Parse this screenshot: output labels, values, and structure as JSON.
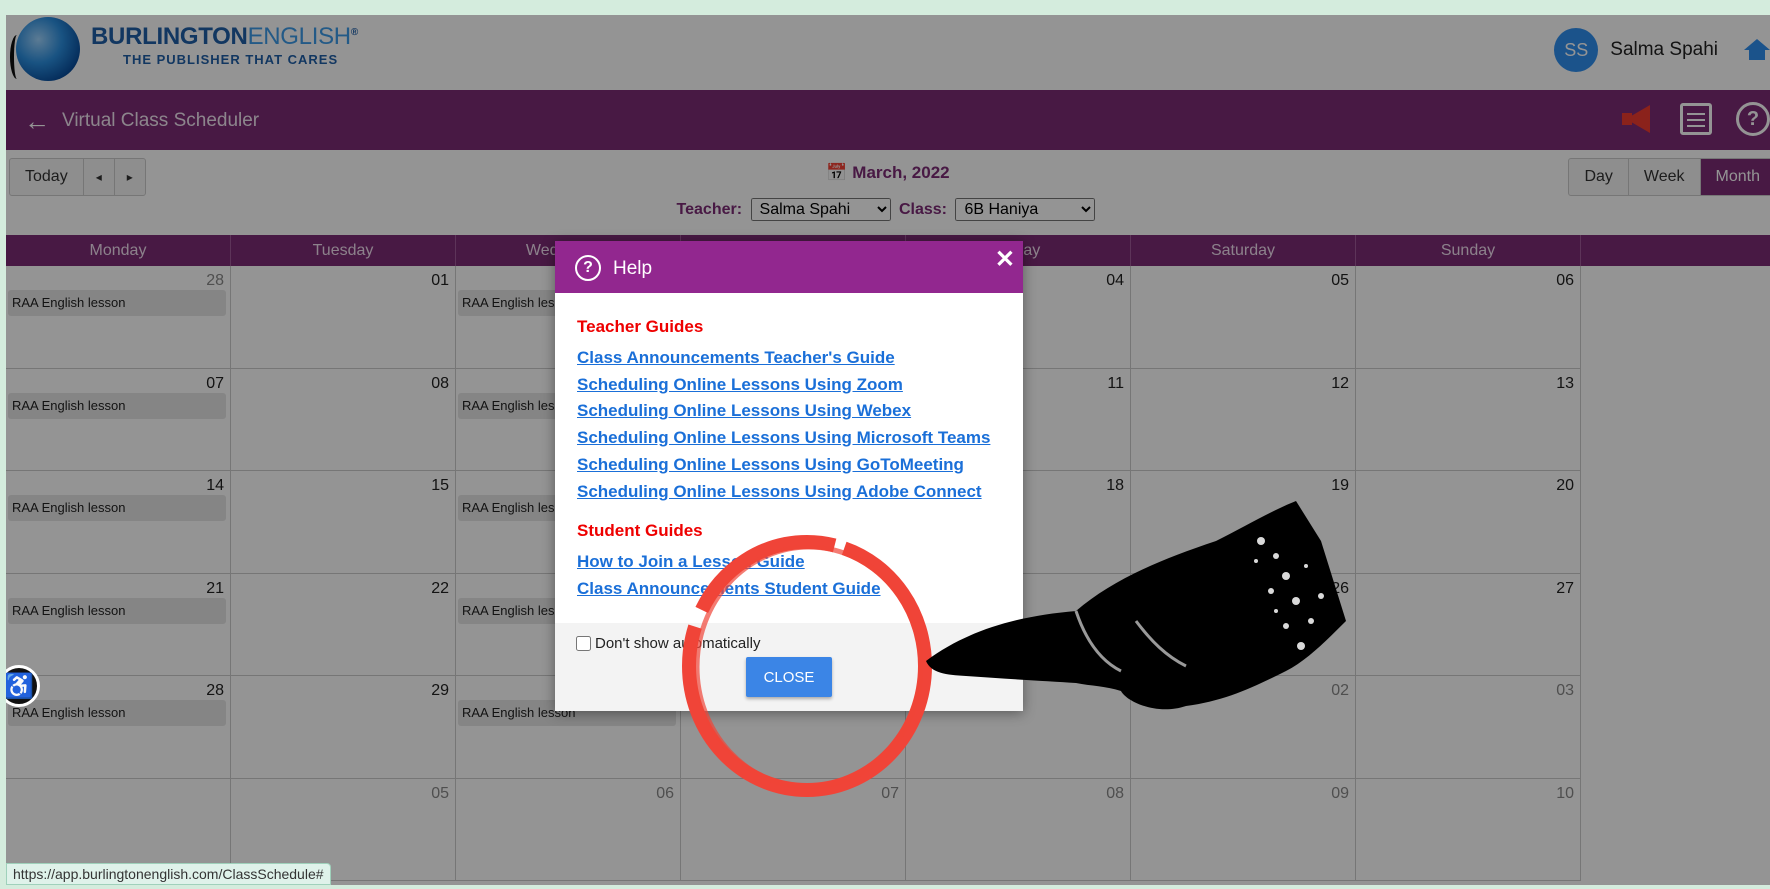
{
  "brand": {
    "name_main": "BURLINGTON",
    "name_accent": "ENGLISH",
    "trademark": "®",
    "tagline": "THE PUBLISHER THAT CARES"
  },
  "user": {
    "initials": "SS",
    "name": "Salma Spahi"
  },
  "header": {
    "title": "Virtual Class Scheduler"
  },
  "toolbar": {
    "today": "Today",
    "prev": "◂",
    "next": "▸",
    "month_title": "March, 2022",
    "views": [
      "Day",
      "Week",
      "Month"
    ],
    "active_view": "Month",
    "teacher_label": "Teacher:",
    "teacher_value": "Salma Spahi",
    "class_label": "Class:",
    "class_value": "6B Haniya"
  },
  "calendar": {
    "weekdays": [
      "Monday",
      "Tuesday",
      "Wednesday",
      "Thursday",
      "Friday",
      "Saturday",
      "Sunday"
    ],
    "event_label": "RAA English lesson",
    "weeks": [
      {
        "days": [
          "28",
          "01",
          "",
          "",
          "04",
          "05",
          "06"
        ],
        "dim": [
          true,
          false,
          false,
          false,
          false,
          false,
          false
        ],
        "events": [
          true,
          false,
          true,
          false,
          false,
          false,
          false
        ]
      },
      {
        "days": [
          "07",
          "08",
          "",
          "",
          "11",
          "12",
          "13"
        ],
        "dim": [
          false,
          false,
          false,
          false,
          false,
          false,
          false
        ],
        "events": [
          true,
          false,
          true,
          false,
          false,
          false,
          false
        ]
      },
      {
        "days": [
          "14",
          "15",
          "",
          "",
          "18",
          "19",
          "20"
        ],
        "dim": [
          false,
          false,
          false,
          false,
          false,
          false,
          false
        ],
        "events": [
          true,
          false,
          true,
          false,
          false,
          false,
          false
        ]
      },
      {
        "days": [
          "21",
          "22",
          "",
          "",
          "",
          "26",
          "27"
        ],
        "dim": [
          false,
          false,
          false,
          false,
          false,
          false,
          false
        ],
        "events": [
          true,
          false,
          true,
          false,
          false,
          false,
          false
        ]
      },
      {
        "days": [
          "28",
          "29",
          "",
          "",
          "",
          "02",
          "03"
        ],
        "dim": [
          false,
          false,
          false,
          false,
          false,
          true,
          true
        ],
        "events": [
          true,
          false,
          true,
          false,
          false,
          false,
          false
        ]
      },
      {
        "days": [
          "",
          "05",
          "06",
          "07",
          "08",
          "09",
          "10"
        ],
        "dim": [
          false,
          true,
          true,
          true,
          true,
          true,
          true
        ],
        "events": [
          false,
          false,
          false,
          false,
          false,
          false,
          false
        ]
      }
    ]
  },
  "status_url": "https://app.burlingtonenglish.com/ClassSchedule#",
  "modal": {
    "title": "Help",
    "close_x": "✕",
    "teacher_title": "Teacher Guides",
    "teacher_links": [
      "Class Announcements Teacher's Guide",
      "Scheduling Online Lessons Using Zoom",
      "Scheduling Online Lessons Using Webex",
      "Scheduling Online Lessons Using Microsoft Teams",
      "Scheduling Online Lessons Using GoToMeeting",
      "Scheduling Online Lessons Using Adobe Connect"
    ],
    "student_title": "Student Guides",
    "student_links": [
      "How to Join a Lesson Guide",
      "Class Announcements Student Guide"
    ],
    "checkbox_label": "Don't show automatically",
    "close_button": "CLOSE"
  },
  "colors": {
    "brand_purple": "#7c2b76",
    "modal_purple": "#92278f",
    "link_blue": "#1a6fd8",
    "guide_red": "#e00000",
    "annotation_red": "#f04438"
  }
}
